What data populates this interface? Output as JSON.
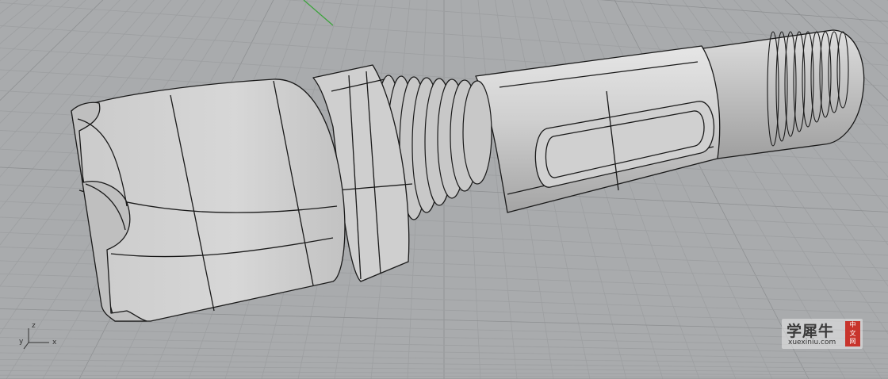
{
  "viewport": {
    "axis_labels": {
      "z": "z",
      "y": "y",
      "x": "x"
    }
  },
  "watermark": {
    "name": "学犀牛",
    "domain": "xuexiniu.com",
    "stamp": [
      "中",
      "文",
      "网"
    ]
  },
  "colors": {
    "background": "#a9abad",
    "grid_minor": "#9d9fa1",
    "grid_major": "#8e9092",
    "y_axis": "#3aa33a",
    "model_fill": "#d2d2d2",
    "model_line": "#1a1a1a",
    "stamp": "#c8342c"
  },
  "icons": [
    "axis-gizmo-icon",
    "flashlight-model"
  ]
}
